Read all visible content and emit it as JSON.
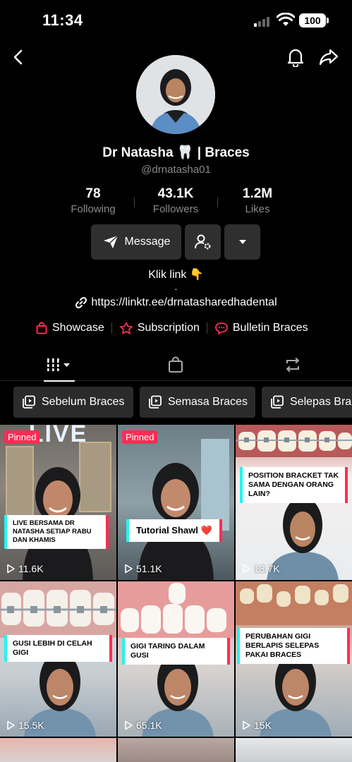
{
  "status": {
    "time": "11:34",
    "battery": "100"
  },
  "profile": {
    "name": "Dr Natasha 🦷 | Braces",
    "handle": "@drnatasha01",
    "stats": [
      {
        "value": "78",
        "label": "Following"
      },
      {
        "value": "43.1K",
        "label": "Followers"
      },
      {
        "value": "1.2M",
        "label": "Likes"
      }
    ],
    "message_label": "Message",
    "bio": {
      "line1": "Klik link 👇",
      "dot": "."
    },
    "link": "https://linktr.ee/drnatasharedhadental",
    "chips": [
      "Showcase",
      "Subscription",
      "Bulletin Braces"
    ]
  },
  "playlists": [
    "Sebelum Braces",
    "Semasa Braces",
    "Selepas Braces"
  ],
  "videos": [
    {
      "pinned_label": "Pinned",
      "caption": "LIVE BERSAMA DR NATASHA SETIAP RABU DAN KHAMIS",
      "views": "11.6K",
      "top_text": "LIVE"
    },
    {
      "pinned_label": "Pinned",
      "caption": "Tutorial Shawl ❤️",
      "views": "51.1K"
    },
    {
      "caption": "POSITION BRACKET TAK SAMA DENGAN ORANG LAIN?",
      "views": "13.7K"
    },
    {
      "caption": "GUSI LEBIH DI CELAH GIGI",
      "views": "15.5K"
    },
    {
      "caption": "GIGI TARING DALAM GUSI",
      "views": "65.1K"
    },
    {
      "caption": "PERUBAHAN GIGI BERLAPIS SELEPAS PAKAI BRACES",
      "views": "15K"
    }
  ],
  "colors": {
    "accent": "#fe2c55",
    "cyan": "#25f4ee",
    "button_bg": "#2f2f2f"
  }
}
